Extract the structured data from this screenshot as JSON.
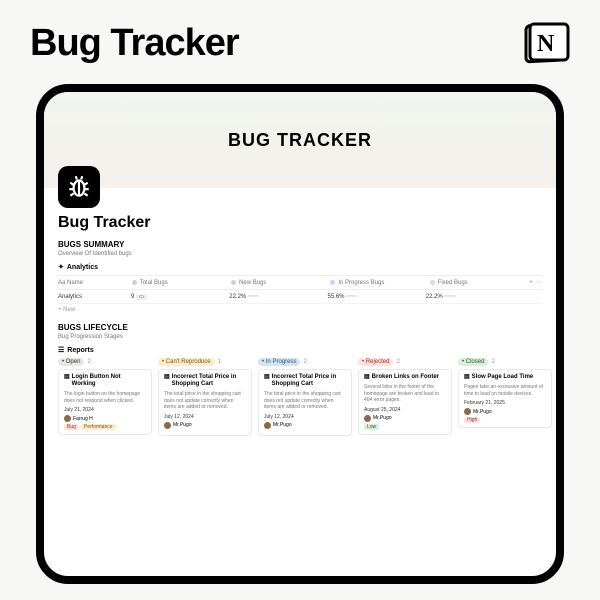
{
  "header": {
    "title": "Bug Tracker"
  },
  "hero": {
    "title": "BUG TRACKER"
  },
  "workspace": {
    "title": "Bug Tracker"
  },
  "summary": {
    "heading": "BUGS SUMMARY",
    "sub": "Overview Of Identified bugs",
    "tab": "Analytics",
    "cols": {
      "name": "Aa Name",
      "total": "Total Bugs",
      "new": "New Bugs",
      "inprog": "In Progress Bugs",
      "fixed": "Fixed Bugs"
    },
    "row": {
      "name": "Analytics",
      "total": "9",
      "new": "22.2%",
      "inprog": "55.6%",
      "fixed": "22.2%"
    },
    "new": "+ New",
    "more": "+ ···"
  },
  "lifecycle": {
    "heading": "BUGS LIFECYCLE",
    "sub": "Bug Progression Stages",
    "tab": "Reports",
    "columns": [
      {
        "label": "Open",
        "count": "2",
        "cls": "open"
      },
      {
        "label": "Can't Reproduce",
        "count": "1",
        "cls": "cant"
      },
      {
        "label": "In Progress",
        "count": "2",
        "cls": "inprog"
      },
      {
        "label": "Rejected",
        "count": "2",
        "cls": "reject"
      },
      {
        "label": "Closed",
        "count": "2",
        "cls": "closed"
      }
    ],
    "cards": [
      {
        "title": "Login Button Not Working",
        "desc": "The login button on the homepage does not respond when clicked.",
        "date": "July 21, 2024",
        "user": "Farrug H",
        "tags": [
          {
            "t": "Bug",
            "c": "bug"
          },
          {
            "t": "Performance",
            "c": "perf"
          }
        ]
      },
      {
        "title": "Incorrect Total Price in Shopping Cart",
        "desc": "The total price in the shopping cart does not update correctly when items are added or removed.",
        "date": "July 12, 2024",
        "user": "Mr.Pugo",
        "tags": []
      },
      {
        "title": "Incorrect Total Price in Shopping Cart",
        "desc": "The total price in the shopping cart does not update correctly when items are added or removed.",
        "date": "July 12, 2024",
        "user": "Mr.Pugo",
        "tags": []
      },
      {
        "title": "Broken Links on Footer",
        "desc": "Several links in the footer of the homepage are broken and lead to 404 error pages.",
        "date": "August 25, 2024",
        "user": "Mr.Pugo",
        "tags": [
          {
            "t": "Low",
            "c": "low"
          }
        ]
      },
      {
        "title": "Slow Page Load Time",
        "desc": "Pages take an excessive amount of time to load on mobile devices.",
        "date": "February 21, 2025",
        "user": "Mr.Pugo",
        "tags": [
          {
            "t": "High",
            "c": "high"
          }
        ]
      }
    ]
  }
}
